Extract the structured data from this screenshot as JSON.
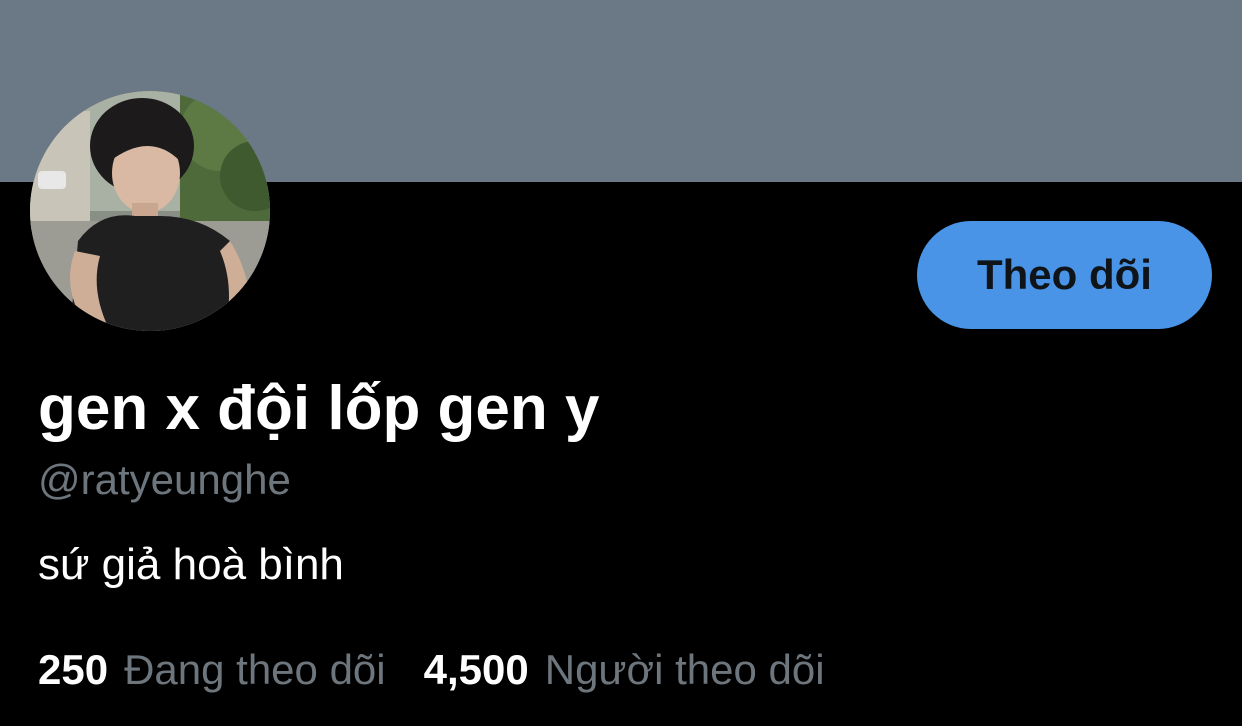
{
  "profile": {
    "banner_color": "#6b7886",
    "display_name": "gen x đội lốp gen y",
    "handle": "@ratyeunghe",
    "bio": "sứ giả hoà bình",
    "follow_button_label": "Theo dõi",
    "follow_button_color": "#4a94e8",
    "stats": {
      "following_count": "250",
      "following_label": "Đang theo dõi",
      "followers_count": "4,500",
      "followers_label": "Người theo dõi"
    }
  }
}
